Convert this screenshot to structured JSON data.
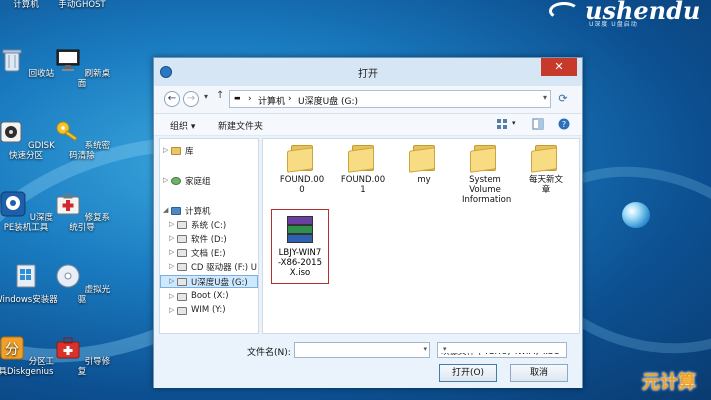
{
  "desktop": {
    "icons": [
      {
        "label": "计算机"
      },
      {
        "label": "手动GHOST"
      },
      {
        "label": "回收站"
      },
      {
        "label": "刷新桌面"
      },
      {
        "label": "GDISK快速分区"
      },
      {
        "label": "系统密码清除"
      },
      {
        "label": "U深度PE装机工具"
      },
      {
        "label": "修复系统引导"
      },
      {
        "label": "Windows安装器"
      },
      {
        "label": "虚拟光驱"
      },
      {
        "label": "分区工具Diskgenius"
      },
      {
        "label": "引导修复"
      }
    ],
    "logo": {
      "text": "ushendu",
      "sub": "U深度 U盘启动"
    },
    "watermark": "元计算"
  },
  "dialog": {
    "title": "打开",
    "close": "✕",
    "address": {
      "segments": [
        "▬",
        "›",
        "计算机",
        "›",
        "U深度U盘 (G:)"
      ]
    },
    "toolbar": {
      "organize": "组织 ▾",
      "new_folder": "新建文件夹"
    },
    "nav": [
      {
        "label": "库",
        "level": 0,
        "arrow": "▷"
      },
      {
        "label": "家庭组",
        "level": 0,
        "arrow": "▷"
      },
      {
        "label": "计算机",
        "level": 0,
        "arrow": "◢"
      },
      {
        "label": "系统 (C:)",
        "level": 1,
        "arrow": "▷"
      },
      {
        "label": "软件 (D:)",
        "level": 1,
        "arrow": "▷"
      },
      {
        "label": "文档 (E:)",
        "level": 1,
        "arrow": "▷"
      },
      {
        "label": "CD 驱动器 (F:) U",
        "level": 1,
        "arrow": "▷"
      },
      {
        "label": "U深度U盘 (G:)",
        "level": 1,
        "arrow": "▷",
        "selected": true
      },
      {
        "label": "Boot (X:)",
        "level": 1,
        "arrow": "▷"
      },
      {
        "label": "WIM (Y:)",
        "level": 1,
        "arrow": "▷"
      }
    ],
    "files": [
      {
        "name": "FOUND.000",
        "type": "folder"
      },
      {
        "name": "FOUND.001",
        "type": "folder"
      },
      {
        "name": "my",
        "type": "folder"
      },
      {
        "name": "System Volume Information",
        "type": "folder"
      },
      {
        "name": "每天新文章",
        "type": "folder"
      },
      {
        "name": "LBJY-WIN7-X86-2015X.iso",
        "type": "iso",
        "selected": true
      }
    ],
    "filename_label": "文件名(N):",
    "filename_value": "",
    "filetype": "映像文件 (*.GHO;*.WIM;*.ISO",
    "open_button": "打开(O)",
    "cancel_button": "取消"
  }
}
